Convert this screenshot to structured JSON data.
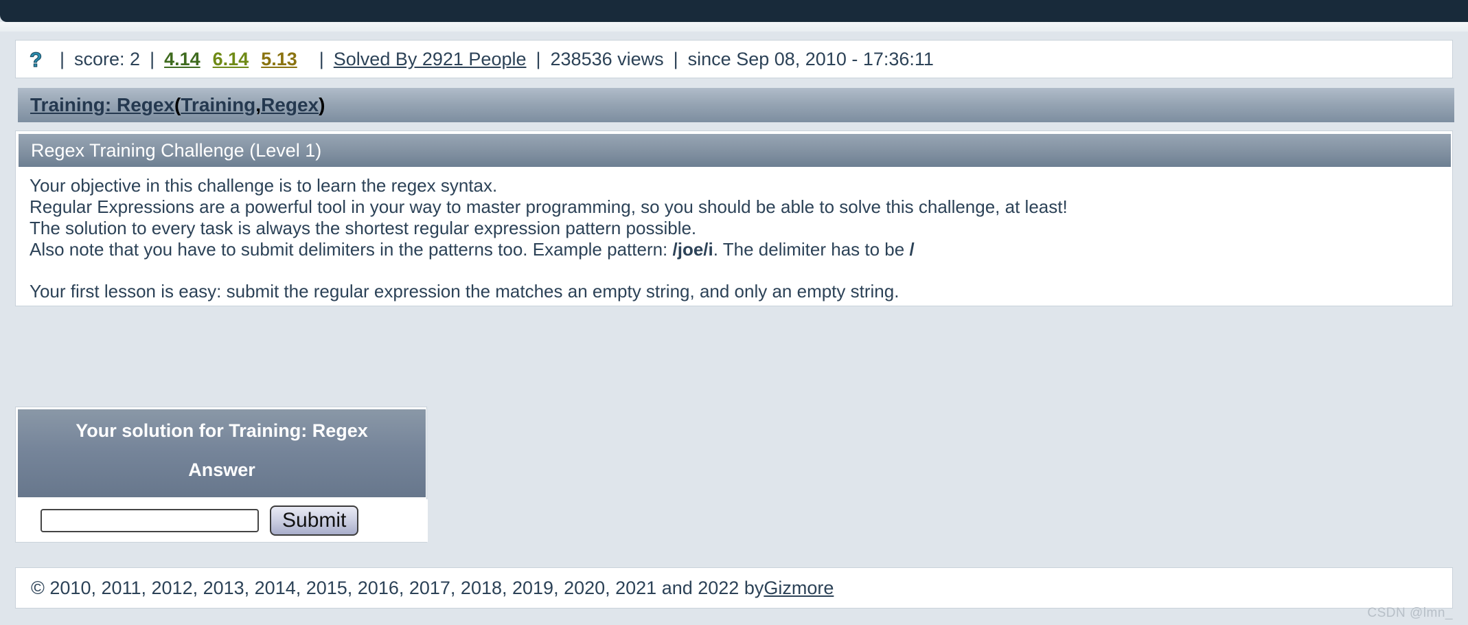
{
  "topbar": {
    "label": ""
  },
  "stats": {
    "help_icon": "question-mark-icon",
    "score_label": "score: 2",
    "separator": "|",
    "score_links": [
      {
        "value": "4.14",
        "color": "#3f6b1f"
      },
      {
        "value": "6.14",
        "color": "#6f8a16"
      },
      {
        "value": "5.13",
        "color": "#8a7310"
      }
    ],
    "solved_by": "Solved By 2921 People",
    "views": "238536 views",
    "since": "since Sep 08, 2010 - 17:36:11"
  },
  "breadcrumb": {
    "main": "Training: Regex",
    "open_paren": "(",
    "first": "Training",
    "comma": ", ",
    "second": "Regex",
    "close_paren": ")"
  },
  "challenge": {
    "title": "Regex Training Challenge (Level 1)",
    "lines": [
      "Your objective in this challenge is to learn the regex syntax.",
      "Regular Expressions are a powerful tool in your way to master programming, so you should be able to solve this challenge, at least!",
      "The solution to every task is always the shortest regular expression pattern possible."
    ],
    "delimiter_line": {
      "before": "Also note that you have to submit delimiters in the patterns too. Example pattern: ",
      "pattern": "/joe/i",
      "middle": ". The delimiter has to be ",
      "delimiter": "/"
    },
    "lesson_line": "Your first lesson is easy: submit the regular expression the matches an empty string, and only an empty string."
  },
  "solution": {
    "header": "Your solution for Training: Regex",
    "answer_label": "Answer",
    "input_value": "",
    "input_placeholder": "",
    "submit_label": "Submit"
  },
  "footer": {
    "copyright": "© 2010, 2011, 2012, 2013, 2014, 2015, 2016, 2017, 2018, 2019, 2020, 2021 and 2022 by ",
    "author": "Gizmore"
  },
  "watermark": {
    "text": "CSDN @lmn_"
  }
}
